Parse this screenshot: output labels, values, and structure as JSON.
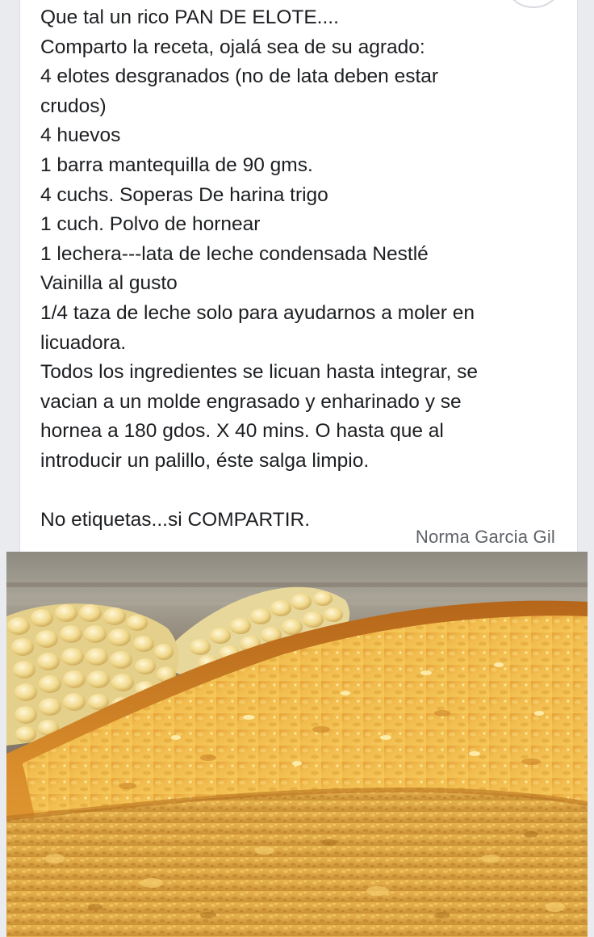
{
  "post": {
    "lines": [
      "Que tal un rico PAN DE ELOTE....",
      "Comparto la receta, ojalá sea de su agrado:",
      "4 elotes desgranados (no de lata deben estar",
      "crudos)",
      "4 huevos",
      "1 barra mantequilla de 90 gms.",
      "4 cuchs. Soperas De harina trigo",
      "1 cuch. Polvo de hornear",
      "1 lechera---lata de leche condensada Nestlé",
      "Vainilla al gusto",
      "1/4 taza de leche solo para ayudarnos a moler en",
      "licuadora.",
      "Todos los ingredientes se licuan hasta integrar, se",
      "vacian a un molde engrasado y enharinado y se",
      "hornea a 180 gdos. X 40 mins. O hasta que al",
      "introducir un palillo, éste salga limpio.",
      "",
      "No etiquetas...si COMPARTIR."
    ],
    "signature": "Norma Garcia Gil"
  },
  "photo": {
    "subject": "corn-bread-with-corn-cobs"
  },
  "colors": {
    "page_background": "#e9ebee",
    "card_background": "#ffffff",
    "text": "#1c1e21",
    "signature_text": "#5f6368"
  }
}
